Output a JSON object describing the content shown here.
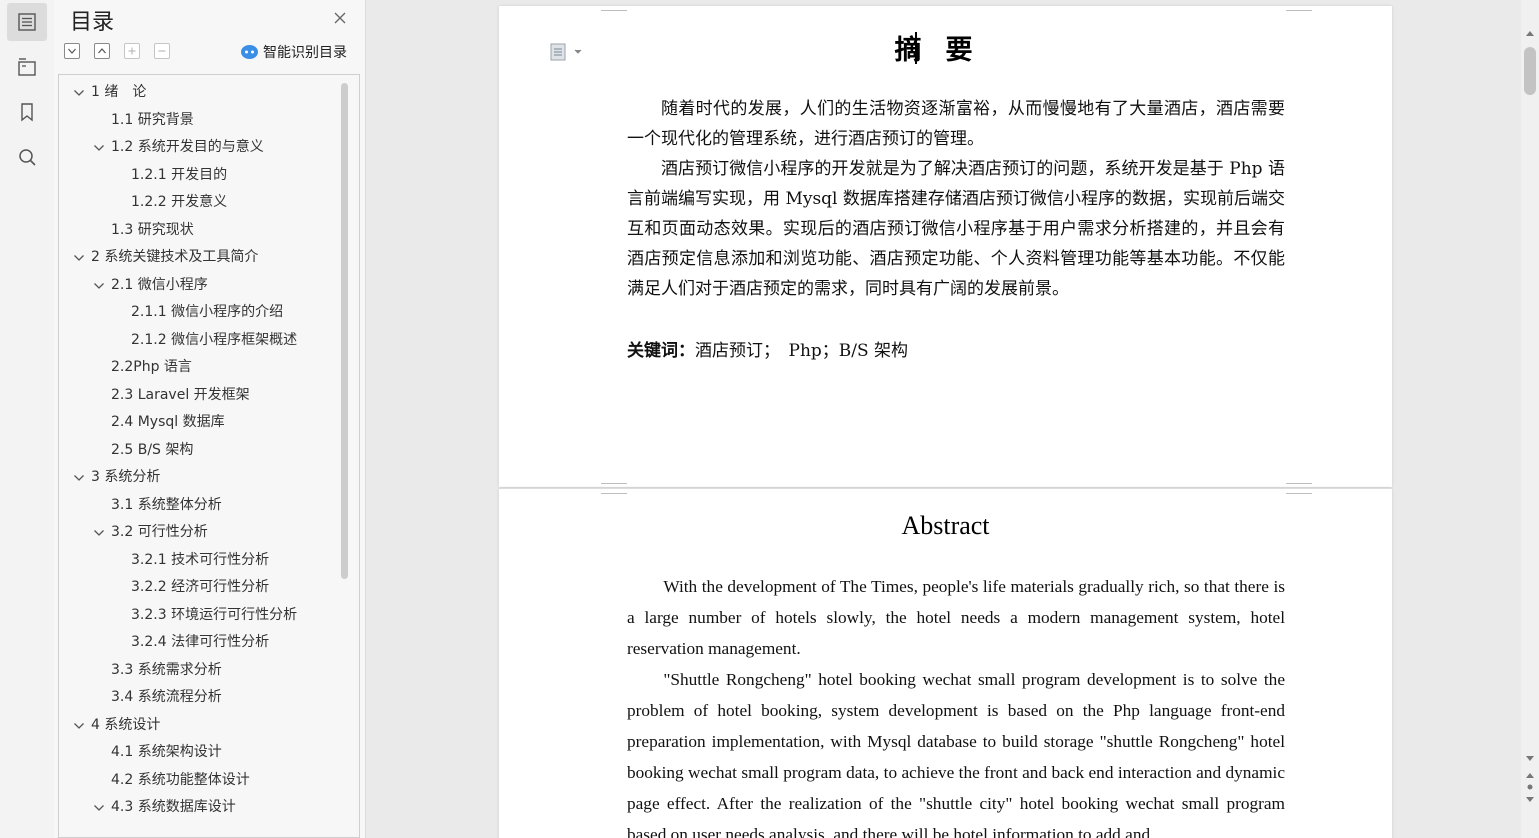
{
  "toc_panel": {
    "title": "目录",
    "smart_toc_label": "智能识别目录",
    "items": [
      {
        "label": "1  绪　论",
        "level": 1,
        "expanded": true
      },
      {
        "label": "1.1 研究背景",
        "level": 2
      },
      {
        "label": "1.2 系统开发目的与意义",
        "level": 2,
        "expanded": true
      },
      {
        "label": "1.2.1  开发目的",
        "level": 3
      },
      {
        "label": "1.2.2  开发意义",
        "level": 3
      },
      {
        "label": "1.3 研究现状",
        "level": 2
      },
      {
        "label": "2 系统关键技术及工具简介",
        "level": 1,
        "expanded": true
      },
      {
        "label": "2.1 微信小程序",
        "level": 2,
        "expanded": true
      },
      {
        "label": "2.1.1 微信小程序的介绍",
        "level": 3
      },
      {
        "label": "2.1.2 微信小程序框架概述",
        "level": 3
      },
      {
        "label": "2.2Php 语言",
        "level": 2
      },
      {
        "label": "2.3 Laravel 开发框架",
        "level": 2
      },
      {
        "label": "2.4 Mysql 数据库",
        "level": 2
      },
      {
        "label": "2.5 B/S 架构",
        "level": 2
      },
      {
        "label": "3  系统分析",
        "level": 1,
        "expanded": true
      },
      {
        "label": "3.1 系统整体分析",
        "level": 2
      },
      {
        "label": "3.2 可行性分析",
        "level": 2,
        "expanded": true
      },
      {
        "label": "3.2.1 技术可行性分析",
        "level": 3
      },
      {
        "label": "3.2.2  经济可行性分析",
        "level": 3
      },
      {
        "label": "3.2.3  环境运行可行性分析",
        "level": 3
      },
      {
        "label": "3.2.4  法律可行性分析",
        "level": 3
      },
      {
        "label": "3.3 系统需求分析",
        "level": 2
      },
      {
        "label": "3.4 系统流程分析",
        "level": 2
      },
      {
        "label": "4  系统设计",
        "level": 1,
        "expanded": true
      },
      {
        "label": "4.1  系统架构设计",
        "level": 2
      },
      {
        "label": "4.2  系统功能整体设计",
        "level": 2
      },
      {
        "label": "4.3  系统数据库设计",
        "level": 2,
        "expanded": true
      }
    ]
  },
  "document": {
    "abstract_cn": {
      "heading": "摘要",
      "paragraphs": [
        "随着时代的发展，人们的生活物资逐渐富裕，从而慢慢地有了大量酒店，酒店需要一个现代化的管理系统，进行酒店预订的管理。",
        "酒店预订微信小程序的开发就是为了解决酒店预订的问题，系统开发是基于 Php 语言前端编写实现，用 Mysql 数据库搭建存储酒店预订微信小程序的数据，实现前后端交互和页面动态效果。实现后的酒店预订微信小程序基于用户需求分析搭建的，并且会有酒店预定信息添加和浏览功能、酒店预定功能、个人资料管理功能等基本功能。不仅能满足人们对于酒店预定的需求，同时具有广阔的发展前景。"
      ],
      "keywords_label": "关键词：",
      "keywords": "酒店预订；　Php；B/S 架构"
    },
    "abstract_en": {
      "heading": "Abstract",
      "paragraphs": [
        "With the development of The Times, people's life materials gradually rich, so that there is a large number of hotels slowly, the hotel needs a modern management system, hotel reservation management.",
        "\"Shuttle Rongcheng\" hotel booking wechat small program development is to solve the problem of hotel booking, system development is based on the Php language front-end preparation implementation, with Mysql database to build storage \"shuttle Rongcheng\" hotel booking wechat small program data, to achieve the front and back end interaction and dynamic page effect. After the realization of the \"shuttle city\" hotel booking wechat small program based on user needs analysis, and there will be hotel information to add and"
      ]
    }
  },
  "colors": {
    "rail_active": "#dcdcdc",
    "smart_icon": "#3a8ee6",
    "page_bg": "#ffffff",
    "canvas_bg": "#eaeaea"
  }
}
